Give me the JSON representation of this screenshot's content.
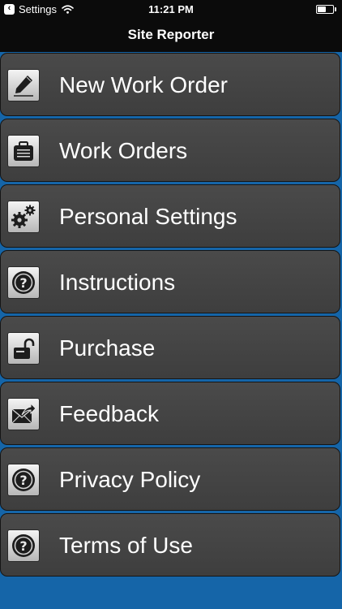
{
  "status_bar": {
    "back_app": "Settings",
    "time": "11:21 PM",
    "battery_level": 0.65
  },
  "nav": {
    "title": "Site Reporter"
  },
  "menu": {
    "items": [
      {
        "label": "New Work Order",
        "icon": "pencil-icon"
      },
      {
        "label": "Work Orders",
        "icon": "briefcase-icon"
      },
      {
        "label": "Personal Settings",
        "icon": "gears-icon"
      },
      {
        "label": "Instructions",
        "icon": "question-icon"
      },
      {
        "label": "Purchase",
        "icon": "unlock-icon"
      },
      {
        "label": "Feedback",
        "icon": "mail-icon"
      },
      {
        "label": "Privacy Policy",
        "icon": "question-icon"
      },
      {
        "label": "Terms of Use",
        "icon": "question-icon"
      }
    ]
  },
  "colors": {
    "background": "#1565a8",
    "bar": "#0b0b0b",
    "button": "#454545"
  }
}
